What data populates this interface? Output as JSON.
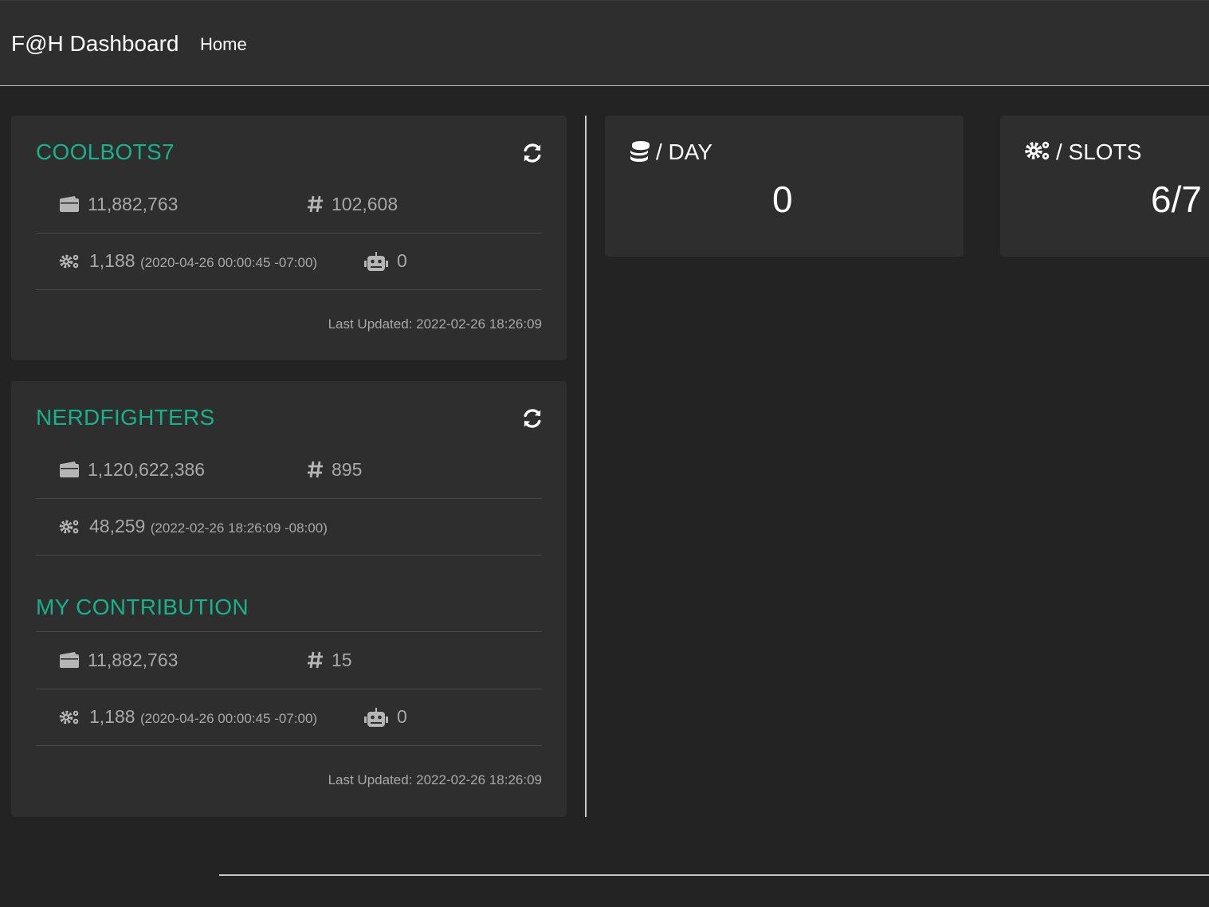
{
  "navbar": {
    "brand": "F@H Dashboard",
    "home": "Home"
  },
  "teams": [
    {
      "name": "COOLBOTS7",
      "score": "11,882,763",
      "rank": "102,608",
      "work_units": "1,188",
      "work_units_date": "(2020-04-26 00:00:45 -07:00)",
      "active_bots": "0",
      "last_updated": "Last Updated: 2022-02-26 18:26:09"
    },
    {
      "name": "NERDFIGHTERS",
      "score": "1,120,622,386",
      "rank": "895",
      "work_units": "48,259",
      "work_units_date": "(2022-02-26 18:26:09 -08:00)"
    }
  ],
  "contribution": {
    "title": "MY CONTRIBUTION",
    "score": "11,882,763",
    "rank": "15",
    "work_units": "1,188",
    "work_units_date": "(2020-04-26 00:00:45 -07:00)",
    "active_bots": "0",
    "last_updated": "Last Updated: 2022-02-26 18:26:09"
  },
  "metrics": {
    "per_day": {
      "label": "/ DAY",
      "value": "0"
    },
    "slots": {
      "label": "/ SLOTS",
      "value": "6/7"
    }
  },
  "colors": {
    "accent": "#18b28a",
    "card": "#2e2e2e",
    "background": "#232323",
    "muted": "#a8a8a8"
  },
  "icons": [
    "refresh-icon",
    "wallet-icon",
    "hashtag-icon",
    "gears-icon",
    "robot-icon",
    "coins-icon"
  ]
}
